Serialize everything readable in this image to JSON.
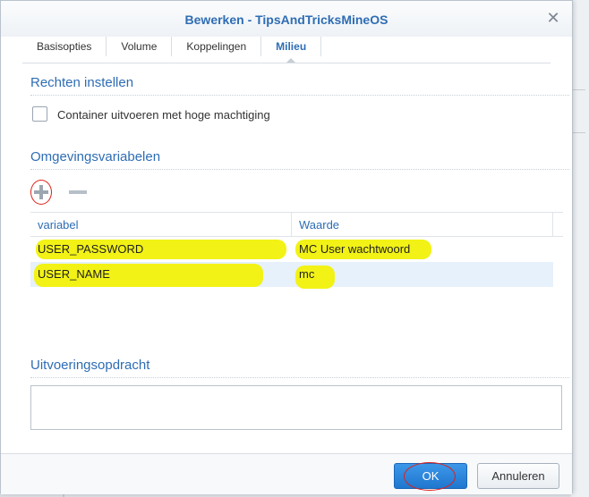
{
  "dialog": {
    "title": "Bewerken - TipsAndTricksMineOS",
    "close_glyph": "✕"
  },
  "tabs": [
    {
      "label": "Basisopties",
      "active": false
    },
    {
      "label": "Volume",
      "active": false
    },
    {
      "label": "Koppelingen",
      "active": false
    },
    {
      "label": "Milieu",
      "active": true
    }
  ],
  "rights": {
    "heading": "Rechten instellen",
    "checkbox_label": "Container uitvoeren met hoge machtiging",
    "checked": false
  },
  "env": {
    "heading": "Omgevingsvariabelen",
    "add_icon": "plus-icon",
    "remove_icon": "minus-icon",
    "columns": [
      "variabel",
      "Waarde"
    ],
    "rows": [
      {
        "variable": "USER_PASSWORD",
        "value": "MC User wachtwoord",
        "selected": false
      },
      {
        "variable": "USER_NAME",
        "value": "mc",
        "selected": true
      }
    ]
  },
  "command": {
    "heading": "Uitvoeringsopdracht",
    "value": ""
  },
  "footer": {
    "ok_label": "OK",
    "cancel_label": "Annuleren"
  },
  "colors": {
    "accent": "#2e6db4",
    "primary_button": "#1f77cf",
    "annotation_highlight": "#f2f216",
    "annotation_circle": "#e0201a"
  }
}
